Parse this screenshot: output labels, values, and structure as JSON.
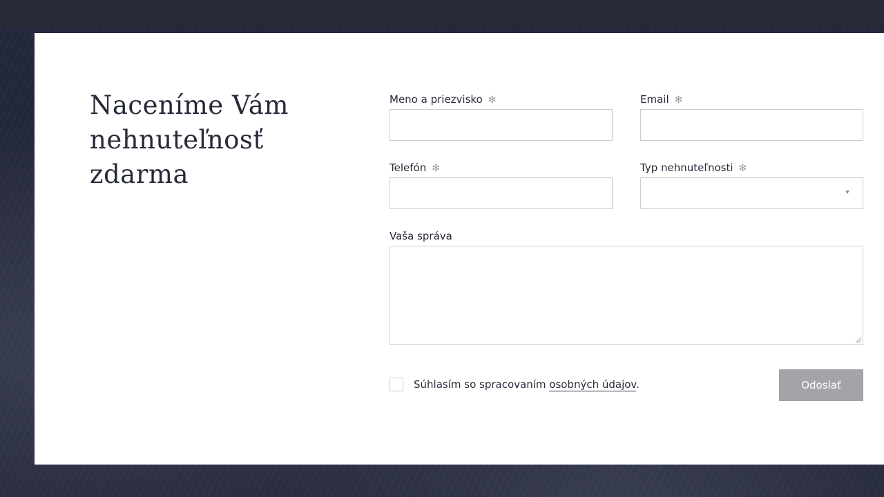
{
  "form": {
    "heading_line1": "Naceníme Vám",
    "heading_line2": "nehnuteľnosť",
    "heading_line3": "zdarma",
    "required_mark": "✻",
    "name": {
      "label": "Meno a priezvisko",
      "value": ""
    },
    "email": {
      "label": "Email",
      "value": ""
    },
    "phone": {
      "label": "Telefón",
      "value": ""
    },
    "property_type": {
      "label": "Typ nehnuteľnosti",
      "selected": ""
    },
    "message": {
      "label": "Vaša správa",
      "value": ""
    },
    "consent": {
      "text_before": "Súhlasím so spracovaním ",
      "link_text": "osobných údajov",
      "text_after": "."
    },
    "submit_label": "Odoslať"
  },
  "colors": {
    "background": "#222633",
    "card": "#ffffff",
    "text": "#262a38",
    "button": "#a3a4a9",
    "border": "#c9cbd0"
  }
}
